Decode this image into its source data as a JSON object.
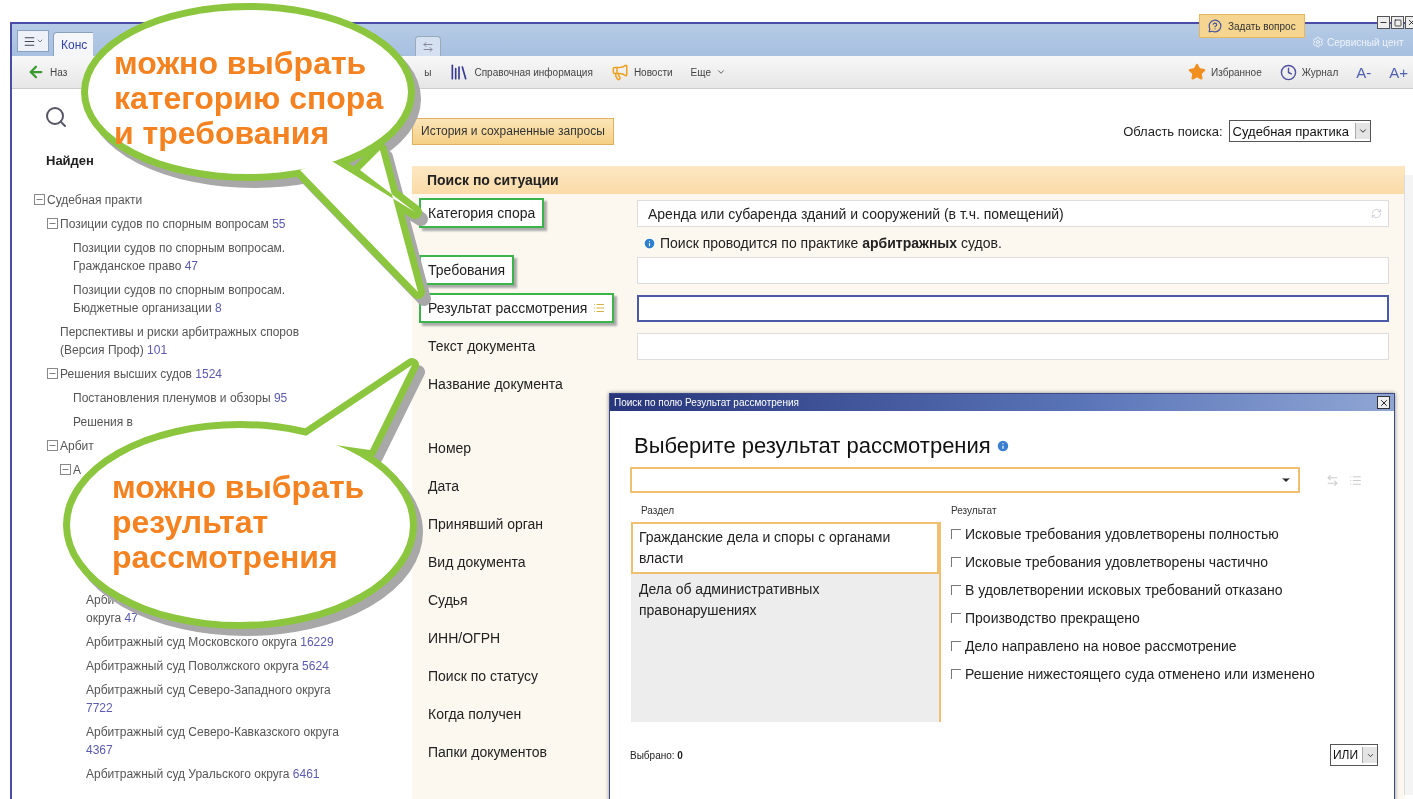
{
  "titlebar": {
    "tab": "Конс",
    "ask_button": "Задать вопрос",
    "service_center": "Сервисный цент"
  },
  "toolbar": {
    "back": "Наз",
    "items": [
      {
        "kind": "plain",
        "label": "ы"
      },
      {
        "kind": "reference",
        "label": "Справочная информация"
      },
      {
        "kind": "news",
        "label": "Новости"
      },
      {
        "kind": "menu",
        "label": "Еще"
      }
    ],
    "right": [
      {
        "kind": "favorites",
        "label": "Избранное"
      },
      {
        "kind": "history",
        "label": "Журнал"
      },
      {
        "kind": "font",
        "label": "A-"
      },
      {
        "kind": "font",
        "label": "A+"
      }
    ]
  },
  "sidebar": {
    "title": "Найден",
    "tree": [
      {
        "label": "Судебная практи",
        "expanded": true,
        "children": [
          {
            "label": "Позиции судов по спорным вопросам",
            "count": "55",
            "expanded": true,
            "children": [
              {
                "label": "Позиции судов по спорным вопросам. Гражданское право",
                "count": "47"
              },
              {
                "label": "Позиции судов по спорным вопросам. Бюджетные организации",
                "count": "8"
              }
            ]
          },
          {
            "label": "Перспективы и риски арбитражных споров (Версия Проф)",
            "count": "101"
          },
          {
            "label": "Решения высших судов",
            "count": "1524",
            "expanded": true,
            "children": [
              {
                "label": "Постановления пленумов и обзоры",
                "count": "95"
              },
              {
                "label": "Решения в"
              }
            ]
          },
          {
            "label": "Арбит",
            "expanded": true,
            "children": [
              {
                "label": "А",
                "expanded": true,
                "children": [
                  {
                    "label": "Арби\nокруга",
                    "count": "47"
                  },
                  {
                    "label": "Арбитражный суд Московского округа",
                    "count": "16229"
                  },
                  {
                    "label": "Арбитражный суд Поволжского округа",
                    "count": "5624"
                  },
                  {
                    "label": "Арбитражный суд Северо-Западного округа",
                    "count": "7722"
                  },
                  {
                    "label": "Арбитражный суд Северо-Кавказского округа",
                    "count": "4367"
                  },
                  {
                    "label": "Арбитражный суд Уральского округа",
                    "count": "6461"
                  }
                ]
              }
            ]
          }
        ]
      }
    ]
  },
  "main": {
    "history_button": "История и сохраненные запросы",
    "scope_label": "Область поиска:",
    "scope_value": "Судебная практика",
    "panel_title": "Поиск по ситуации",
    "groups": [
      {
        "rows": [
          {
            "kind": "input",
            "label": "Категория спора",
            "highlighted": true,
            "focused": false,
            "value": "Аренда или субаренда зданий и сооружений (в т.ч. помещений)",
            "note": "Поиск проводится по практике **арбитражных** судов."
          },
          {
            "kind": "input",
            "label": "Требования",
            "highlighted": true,
            "focused": false
          },
          {
            "kind": "input",
            "label": "Результат рассмотрения",
            "highlighted": true,
            "focused": true,
            "list_icon": true
          },
          {
            "kind": "input",
            "label": "Текст документа",
            "highlighted": false,
            "focused": false
          },
          {
            "kind": "plain",
            "label": "Название документа",
            "highlighted": false
          }
        ]
      },
      {
        "rows": [
          {
            "kind": "plain",
            "label": "Номер",
            "highlighted": false
          },
          {
            "kind": "plain",
            "label": "Дата",
            "highlighted": false
          },
          {
            "kind": "plain",
            "label": "Принявший орган",
            "highlighted": false
          },
          {
            "kind": "plain",
            "label": "Вид документа",
            "highlighted": false
          },
          {
            "kind": "plain",
            "label": "Судья",
            "highlighted": false
          },
          {
            "kind": "plain",
            "label": "ИНН/ОГРН",
            "highlighted": false
          },
          {
            "kind": "plain",
            "label": "Поиск по статусу",
            "highlighted": false
          },
          {
            "kind": "plain",
            "label": "Когда получен",
            "highlighted": false
          },
          {
            "kind": "plain",
            "label": "Папки документов",
            "highlighted": false
          }
        ]
      }
    ]
  },
  "dialog": {
    "title": "Поиск по полю Результат рассмотрения",
    "heading": "Выберите результат рассмотрения",
    "section_header": "Раздел",
    "result_header": "Результат",
    "sections": [
      {
        "label": "Гражданские дела и споры с органами власти",
        "selected": true
      },
      {
        "label": "Дела об административных правонарушениях",
        "selected": false
      }
    ],
    "results": [
      {
        "label": "Исковые требования удовлетворены полностью",
        "checked": false
      },
      {
        "label": "Исковые требования удовлетворены частично",
        "checked": false
      },
      {
        "label": "В удовлетворении исковых требований отказано",
        "checked": false
      },
      {
        "label": "Производство прекращено",
        "checked": false
      },
      {
        "label": "Дело направлено на новое рассмотрение",
        "checked": false
      },
      {
        "label": "Решение нижестоящего суда отменено или изменено",
        "checked": false
      }
    ],
    "selected_count": "Выбрано: **0**",
    "operator": "ИЛИ"
  },
  "callouts": [
    {
      "text": "можно выбрать\nкатегорию спора\nи требования"
    },
    {
      "text": "можно выбрать\nрезультат\nрассмотрения"
    }
  ]
}
